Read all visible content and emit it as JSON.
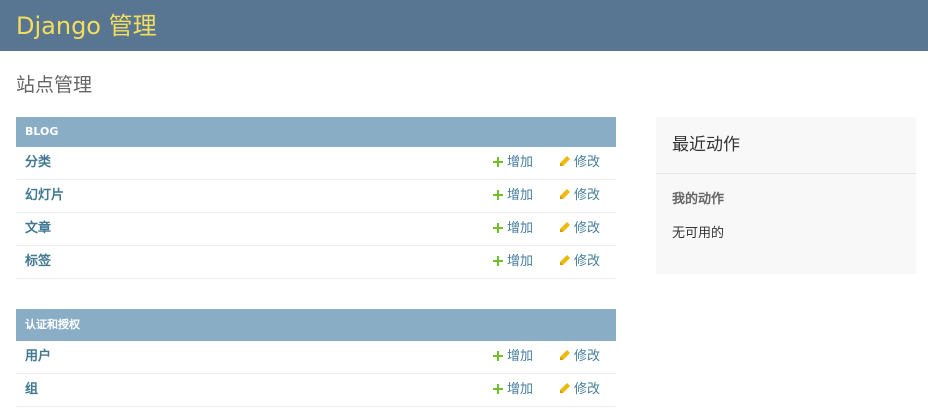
{
  "header": {
    "brand": "Django 管理"
  },
  "page_title": "站点管理",
  "modules": [
    {
      "caption": "BLOG",
      "models": [
        {
          "name": "分类",
          "add_label": "增加",
          "change_label": "修改"
        },
        {
          "name": "幻灯片",
          "add_label": "增加",
          "change_label": "修改"
        },
        {
          "name": "文章",
          "add_label": "增加",
          "change_label": "修改"
        },
        {
          "name": "标签",
          "add_label": "增加",
          "change_label": "修改"
        }
      ]
    },
    {
      "caption": "认证和授权",
      "models": [
        {
          "name": "用户",
          "add_label": "增加",
          "change_label": "修改"
        },
        {
          "name": "组",
          "add_label": "增加",
          "change_label": "修改"
        }
      ]
    }
  ],
  "recent_actions": {
    "title": "最近动作",
    "my_actions_heading": "我的动作",
    "empty_text": "无可用的"
  },
  "icons": {
    "add": "plus-icon",
    "change": "pencil-icon"
  },
  "colors": {
    "header_bg": "#587691",
    "brand_text": "#f5dd5d",
    "module_caption_bg": "#8aadc6",
    "link": "#447e9b",
    "add_icon": "#70bf2b",
    "change_icon": "#efb80b"
  }
}
